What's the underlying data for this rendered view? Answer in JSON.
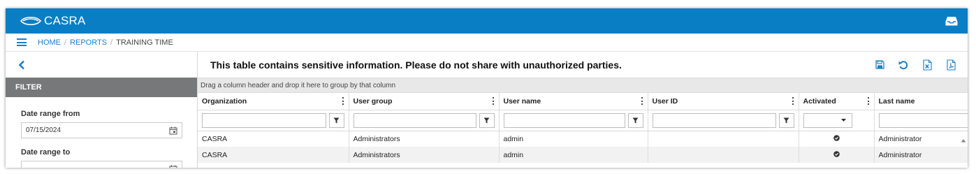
{
  "header": {
    "brand": "CASRA",
    "inbox_icon": "inbox-icon"
  },
  "breadcrumb": {
    "menu_icon": "hamburger-icon",
    "items": [
      "HOME",
      "REPORTS"
    ],
    "separator": "/",
    "current": "TRAINING TIME"
  },
  "sidebar": {
    "back_icon": "chevron-left-icon",
    "filter_title": "FILTER",
    "date_from_label": "Date range from",
    "date_from_value": "07/15/2024",
    "date_to_label": "Date range to",
    "calendar_icon": "calendar-icon"
  },
  "content": {
    "message": "This table contains sensitive information. Please do not share with unauthorized parties.",
    "tools": [
      "save-icon",
      "reset-icon",
      "excel-export-icon",
      "pdf-export-icon"
    ],
    "group_hint": "Drag a column header and drop it here to group by that column"
  },
  "grid": {
    "columns": [
      "Organization",
      "User group",
      "User name",
      "User ID",
      "Activated",
      "Last name"
    ],
    "rows": [
      {
        "organization": "CASRA",
        "user_group": "Administrators",
        "user_name": "admin",
        "user_id": "",
        "activated": true,
        "last_name": "Administrator"
      },
      {
        "organization": "CASRA",
        "user_group": "Administrators",
        "user_name": "admin",
        "user_id": "",
        "activated": true,
        "last_name": "Administrator"
      }
    ]
  },
  "colors": {
    "brand_blue": "#0a7ec4",
    "link_blue": "#1b7fc3",
    "filter_header": "#777879",
    "group_panel": "#e8e8e8"
  }
}
